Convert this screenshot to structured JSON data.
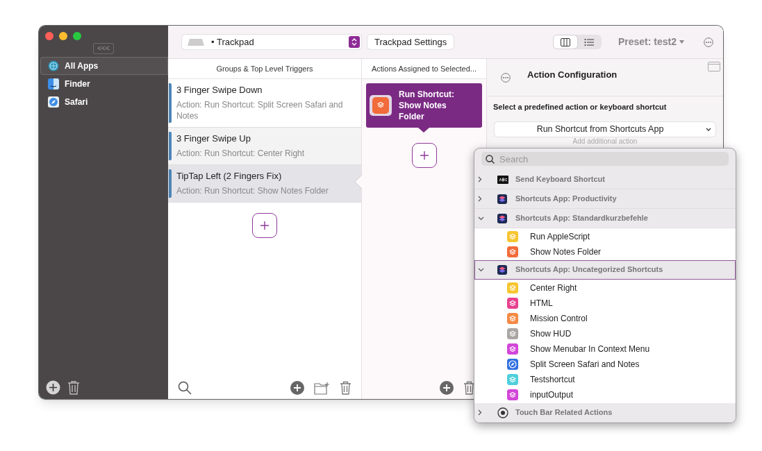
{
  "sidebar": {
    "collapse_button": "<<<",
    "items": [
      {
        "label": "All Apps",
        "kind": "globe",
        "selected": true
      },
      {
        "label": "Finder",
        "kind": "finder",
        "selected": false
      },
      {
        "label": "Safari",
        "kind": "safari",
        "selected": false
      }
    ]
  },
  "toolbar": {
    "device": {
      "label": "• Trackpad"
    },
    "settings_button": "Trackpad Settings",
    "view_switch": [
      {
        "kind": "columns",
        "selected": true
      },
      {
        "kind": "list",
        "selected": false
      }
    ],
    "preset": "Preset: test2"
  },
  "triggers": {
    "header": "Groups & Top Level Triggers",
    "rows": [
      {
        "title": "3 Finger Swipe Down",
        "subtitle": "Action: Run Shortcut: Split Screen Safari and Notes",
        "selected": false
      },
      {
        "title": "3 Finger Swipe Up",
        "subtitle": "Action: Run Shortcut: Center Right",
        "selected": false
      },
      {
        "title": "TipTap Left (2 Fingers Fix)",
        "subtitle": "Action: Run Shortcut: Show Notes Folder",
        "selected": true
      }
    ]
  },
  "actions": {
    "header": "Actions Assigned to Selected...",
    "cards": [
      {
        "label": "Run Shortcut: Show Notes Folder",
        "color": "#f26b3a"
      }
    ]
  },
  "configuration": {
    "title": "Action Configuration",
    "prompt": "Select a predefined action or keyboard shortcut",
    "dropdown": "Run Shortcut from Shortcuts App",
    "add_action": "Add additional action"
  },
  "popup": {
    "search": {
      "placeholder": "Search"
    },
    "groups": [
      {
        "label": "Send Keyboard Shortcut",
        "kind": "keyboard",
        "expanded": false,
        "selected": false
      },
      {
        "label": "Shortcuts App: Productivity",
        "kind": "shortcuts",
        "expanded": false,
        "selected": false
      },
      {
        "label": "Shortcuts App: Standardkurzbefehle",
        "kind": "shortcuts",
        "expanded": true,
        "selected": false,
        "children": [
          {
            "label": "Run AppleScript",
            "kind": "layers",
            "color": "#f7c531"
          },
          {
            "label": "Show Notes Folder",
            "kind": "layers",
            "color": "#f26b3a"
          }
        ]
      },
      {
        "label": "Shortcuts App: Uncategorized Shortcuts",
        "kind": "shortcuts",
        "expanded": true,
        "selected": true,
        "children": [
          {
            "label": "Center Right",
            "kind": "layers",
            "color": "#f7c531"
          },
          {
            "label": "HTML",
            "kind": "layers",
            "color": "#e8408f"
          },
          {
            "label": "Mission Control",
            "kind": "layers",
            "color": "#f48a45"
          },
          {
            "label": "Show HUD",
            "kind": "layers",
            "color": "#a9a6a3"
          },
          {
            "label": "Show Menubar In Context Menu",
            "kind": "layers",
            "color": "#d345d9"
          },
          {
            "label": "Split Screen Safari and Notes",
            "kind": "compass",
            "color": "#2f6fe0"
          },
          {
            "label": "Testshortcut",
            "kind": "layers",
            "color": "#4fd0dc"
          },
          {
            "label": "inputOutput",
            "kind": "layers",
            "color": "#d345d9"
          }
        ]
      },
      {
        "label": "Touch Bar Related Actions",
        "kind": "touchbar",
        "expanded": false,
        "selected": false
      }
    ]
  }
}
